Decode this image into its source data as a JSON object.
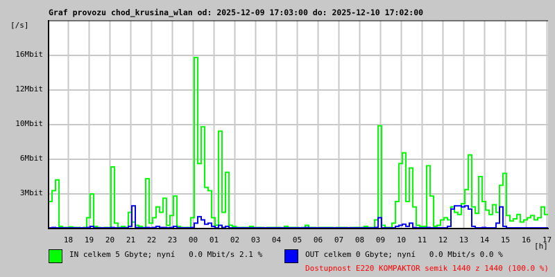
{
  "title": "Graf provozu chod_krusina_wlan od: 2025-12-09 17:03:00 do: 2025-12-10 17:02:00",
  "unit_label": "[/s]",
  "hour_unit_label": "[h]",
  "legend": {
    "in_text": "IN celkem 5 Gbyte; nyní   0.0 Mbit/s 2.1 %",
    "out_text": "OUT celkem 0 Gbyte; nyní   0.0 Mbit/s 0.0 %",
    "availability_text": "Dostupnost E220 KOMPAKTOR semik 1440 z 1440 (100.0 %)"
  },
  "colors": {
    "in": "#00ff00",
    "out": "#0000ff",
    "grid": "#c8c8c8",
    "availability": "#ff0000"
  },
  "chart_data": {
    "type": "line",
    "title": "Graf provozu chod_krusina_wlan",
    "xlabel": "[h]",
    "ylabel": "[/s]",
    "ylim_mbit": [
      0,
      19.2
    ],
    "y_ticks": [
      {
        "value": 3.2,
        "label": "3Mbit"
      },
      {
        "value": 6.4,
        "label": "6Mbit"
      },
      {
        "value": 9.6,
        "label": "10Mbit"
      },
      {
        "value": 12.8,
        "label": "12Mbit"
      },
      {
        "value": 16.0,
        "label": "16Mbit"
      }
    ],
    "x_start_offset_min": 0,
    "x_span_hours": 24,
    "x_first_tick_offset_min": 57,
    "x_tick_labels": [
      "18",
      "19",
      "20",
      "21",
      "22",
      "23",
      "00",
      "01",
      "02",
      "03",
      "04",
      "05",
      "06",
      "07",
      "08",
      "09",
      "10",
      "11",
      "12",
      "13",
      "14",
      "15",
      "16",
      "17"
    ],
    "bin_minutes": 10,
    "grid": true,
    "series": [
      {
        "name": "IN",
        "values": [
          2.5,
          3.5,
          4.5,
          0.2,
          0.1,
          0.1,
          0.15,
          0.1,
          0.1,
          0.05,
          0.1,
          1.0,
          3.2,
          0.2,
          0.1,
          0.05,
          0.1,
          0.1,
          5.7,
          0.5,
          0.1,
          0.2,
          0.1,
          1.5,
          0.6,
          0.3,
          0.2,
          0.1,
          4.6,
          0.5,
          1.0,
          2.0,
          1.5,
          2.8,
          0.3,
          1.2,
          3.0,
          0.2,
          0.1,
          0.1,
          0.1,
          1.0,
          15.8,
          6.0,
          9.4,
          3.8,
          3.5,
          1.0,
          0.3,
          9.0,
          1.5,
          5.2,
          0.3,
          0.2,
          0.1,
          0.1,
          0.1,
          0.1,
          0.2,
          0.1,
          0.1,
          0.1,
          0.05,
          0.1,
          0.1,
          0.1,
          0.1,
          0.05,
          0.2,
          0.1,
          0.1,
          0.1,
          0.05,
          0.1,
          0.3,
          0.1,
          0.1,
          0.05,
          0.1,
          0.1,
          0.1,
          0.1,
          0.05,
          0.1,
          0.1,
          0.1,
          0.05,
          0.1,
          0.1,
          0.1,
          0.1,
          0.2,
          0.1,
          0.1,
          0.8,
          9.5,
          0.3,
          0.1,
          0.1,
          0.5,
          2.5,
          6.0,
          7.0,
          2.5,
          5.6,
          2.0,
          0.3,
          0.2,
          0.2,
          5.8,
          3.0,
          0.2,
          0.3,
          0.8,
          1.0,
          0.8,
          2.0,
          1.5,
          1.3,
          2.3,
          3.6,
          6.8,
          2.0,
          1.4,
          4.8,
          2.5,
          1.7,
          1.3,
          2.2,
          1.5,
          4.0,
          5.1,
          1.2,
          0.7,
          0.9,
          1.3,
          0.6,
          0.8,
          1.0,
          1.2,
          0.8,
          1.0,
          2.0,
          1.3
        ]
      },
      {
        "name": "OUT",
        "values": [
          0.05,
          0.1,
          0.05,
          0,
          0,
          0,
          0,
          0,
          0,
          0,
          0,
          0.1,
          0.2,
          0,
          0,
          0,
          0,
          0,
          0.1,
          0,
          0,
          0,
          0,
          0.2,
          2.1,
          0.1,
          0,
          0,
          0.1,
          0,
          0.1,
          0.2,
          0.1,
          0.1,
          0,
          0.1,
          0.2,
          0,
          0,
          0,
          0,
          0.1,
          0.5,
          1.1,
          0.8,
          0.4,
          0.5,
          0.2,
          0,
          0.3,
          0.1,
          0.2,
          0,
          0,
          0,
          0,
          0,
          0,
          0,
          0,
          0,
          0,
          0,
          0,
          0,
          0,
          0,
          0,
          0,
          0,
          0,
          0,
          0,
          0,
          0.1,
          0,
          0,
          0,
          0,
          0,
          0,
          0,
          0,
          0,
          0,
          0,
          0,
          0,
          0,
          0,
          0,
          0,
          0,
          0,
          0.1,
          1.0,
          0,
          0,
          0,
          0,
          0.2,
          0.3,
          0.4,
          0.2,
          0.5,
          0.1,
          0,
          0,
          0,
          0.1,
          0,
          0,
          0,
          0,
          0,
          0.2,
          1.8,
          2.1,
          2.1,
          2.0,
          2.1,
          1.8,
          0.2,
          0,
          0,
          0.1,
          0,
          0,
          0,
          0.5,
          2.0,
          0.2,
          0,
          0,
          0,
          0,
          0,
          0,
          0,
          0,
          0,
          0,
          0,
          0
        ]
      }
    ]
  }
}
